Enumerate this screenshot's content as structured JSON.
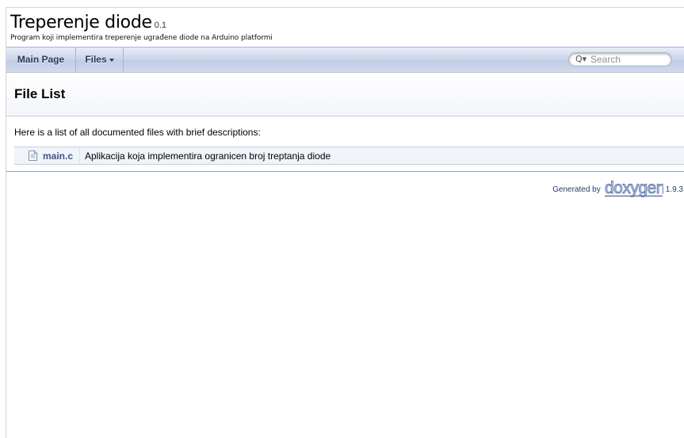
{
  "project": {
    "name": "Treperenje diode",
    "number": "0.1",
    "brief": "Program koji implementira treperenje ugrađene diode na Arduino platformi"
  },
  "navbar": {
    "main_page": "Main Page",
    "files": "Files",
    "search_placeholder": "Search"
  },
  "header": {
    "title": "File List"
  },
  "contents": {
    "intro": "Here is a list of all documented files with brief descriptions:",
    "files": [
      {
        "name": "main.c",
        "description": "Aplikacija koja implementira ogranicen broj treptanja diode",
        "icon": "document-icon"
      }
    ]
  },
  "footer": {
    "generated_by": "Generated by",
    "logo_text": "doxygen",
    "version": "1.9.3"
  },
  "colors": {
    "link": "#3d578c",
    "navbar": "#c0cce5",
    "border": "#c4cfe5"
  }
}
